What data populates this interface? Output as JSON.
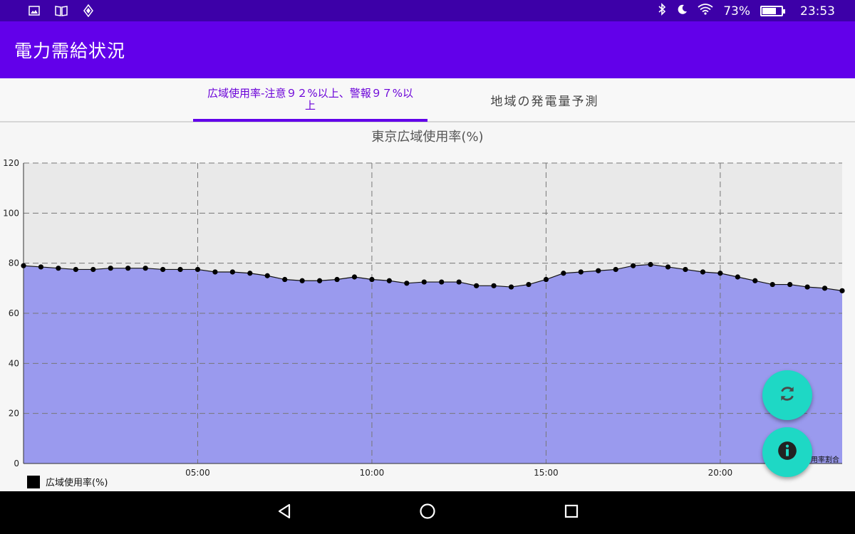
{
  "status_bar": {
    "battery_text": "73%",
    "battery_level": 0.73,
    "time": "23:53",
    "icons": [
      "image-icon",
      "book-icon",
      "app-icon",
      "bluetooth-icon",
      "moon-icon",
      "wifi-icon",
      "battery-icon"
    ]
  },
  "app_bar": {
    "title": "電力需給状況"
  },
  "tabs": [
    {
      "label": "広域使用率-注意９２%以上、警報９７%以上",
      "selected": true
    },
    {
      "label": "地域の発電量予測",
      "selected": false
    }
  ],
  "colors": {
    "status_bar": "#3d00a8",
    "app_bar": "#6200ea",
    "tab_selected": "#6a00d8",
    "area_fill": "#9a9aee",
    "plot_background": "#e9e9e9",
    "fab": "#1ed8c5"
  },
  "chart_data": {
    "type": "area",
    "title": "東京広域使用率(%)",
    "xlabel": "",
    "ylabel": "",
    "ylim": [
      0,
      120
    ],
    "xlim": [
      0,
      23.5
    ],
    "yticks": [
      0,
      20,
      40,
      60,
      80,
      100,
      120
    ],
    "xticks": [
      {
        "value": 5,
        "label": "05:00"
      },
      {
        "value": 10,
        "label": "10:00"
      },
      {
        "value": 15,
        "label": "15:00"
      },
      {
        "value": 20,
        "label": "20:00"
      }
    ],
    "grid": true,
    "legend_position": "bottom-left",
    "description": "用率割合",
    "series": [
      {
        "name": "広域使用率(%)",
        "x": [
          0,
          0.5,
          1,
          1.5,
          2,
          2.5,
          3,
          3.5,
          4,
          4.5,
          5,
          5.5,
          6,
          6.5,
          7,
          7.5,
          8,
          8.5,
          9,
          9.5,
          10,
          10.5,
          11,
          11.5,
          12,
          12.5,
          13,
          13.5,
          14,
          14.5,
          15,
          15.5,
          16,
          16.5,
          17,
          17.5,
          18,
          18.5,
          19,
          19.5,
          20,
          20.5,
          21,
          21.5,
          22,
          22.5,
          23,
          23.5
        ],
        "y": [
          79,
          78.5,
          78,
          77.5,
          77.5,
          78,
          78,
          78,
          77.5,
          77.5,
          77.5,
          76.5,
          76.5,
          76,
          75,
          73.5,
          73,
          73,
          73.5,
          74.5,
          73.5,
          73,
          72,
          72.5,
          72.5,
          72.5,
          71,
          71,
          70.5,
          71.5,
          73.5,
          76,
          76.5,
          77,
          77.5,
          79,
          79.5,
          78.5,
          77.5,
          76.5,
          76,
          74.5,
          73,
          71.5,
          71.5,
          70.5,
          70,
          69
        ]
      }
    ]
  },
  "nav_bar": {
    "buttons": [
      "back",
      "home",
      "recents"
    ]
  }
}
